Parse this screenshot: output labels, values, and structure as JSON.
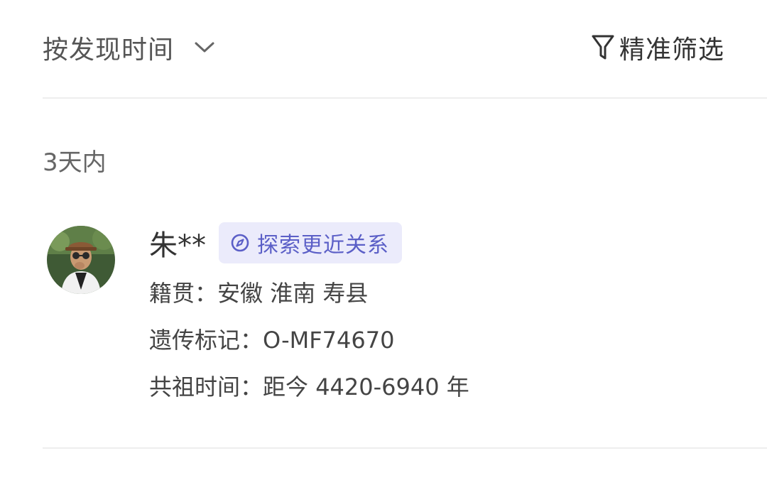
{
  "header": {
    "sort_label": "按发现时间",
    "sort_icon": "chevron-down-icon",
    "filter_label": "精准筛选",
    "filter_icon": "funnel-icon"
  },
  "group": {
    "title": "3天内"
  },
  "match": {
    "name": "朱**",
    "explore_label": "探索更近关系",
    "explore_icon": "compass-icon",
    "details": [
      {
        "label": "籍贯：",
        "value": "安徽 淮南 寿县"
      },
      {
        "label": "遗传标记：",
        "value": "O-MF74670"
      },
      {
        "label": "共祖时间：",
        "value": "距今 4420-6940 年"
      }
    ]
  },
  "colors": {
    "accent": "#5b5fc7",
    "badge_bg": "#ebebfb",
    "divider": "#eeeeee"
  }
}
